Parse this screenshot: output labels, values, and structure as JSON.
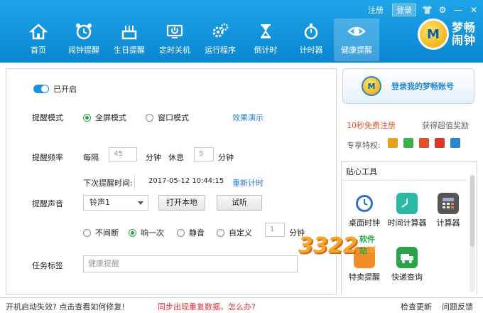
{
  "window": {
    "register_label": "注册",
    "login_label": "登录",
    "icons": [
      "shirt-icon",
      "gear-icon",
      "minimize-icon",
      "close-icon"
    ]
  },
  "nav": {
    "items": [
      {
        "label": "首页",
        "icon": "home-icon"
      },
      {
        "label": "闹钟提醒",
        "icon": "alarm-clock-icon"
      },
      {
        "label": "生日提醒",
        "icon": "birthday-cake-icon"
      },
      {
        "label": "定时关机",
        "icon": "power-icon"
      },
      {
        "label": "运行程序",
        "icon": "gears-icon"
      },
      {
        "label": "倒计时",
        "icon": "hourglass-icon"
      },
      {
        "label": "计时器",
        "icon": "stopwatch-icon"
      },
      {
        "label": "健康提醒",
        "icon": "eye-icon"
      }
    ],
    "active_index": 7
  },
  "brand": {
    "line1": "梦畅",
    "line2": "闹钟",
    "logo_letter": "M"
  },
  "main": {
    "enabled_label": "已开启",
    "mode": {
      "label": "提醒模式",
      "options": [
        "全屏模式",
        "窗口模式"
      ],
      "selected": "全屏模式",
      "demo_link": "效果演示"
    },
    "frequency": {
      "label": "提醒频率",
      "every_label": "每隔",
      "every_value": "45",
      "every_unit": "分钟",
      "rest_label": "休息",
      "rest_value": "5",
      "rest_unit": "分钟",
      "next_label": "下次提醒时间:",
      "next_time": "2017-05-12 10:44:15",
      "reset_link": "重新计时"
    },
    "sound": {
      "label": "提醒声音",
      "selected_sound": "铃声1",
      "open_local_button": "打开本地",
      "listen_button": "试听",
      "options": [
        "不间断",
        "响一次",
        "静音",
        "自定义"
      ],
      "selected_option": "响一次",
      "custom_value": "1",
      "custom_unit": "分钟"
    },
    "task": {
      "label": "任务标签",
      "value": "健康提醒"
    }
  },
  "right": {
    "login_text": "登录我的梦畅账号",
    "free_register": "10秒免费注册",
    "get_reward": "获得超值奖励",
    "vip_label": "专享特权:",
    "tools_title": "贴心工具",
    "tools": [
      {
        "label": "桌面时钟",
        "icon": "desktop-clock-icon"
      },
      {
        "label": "时间计算器",
        "icon": "time-calculator-icon"
      },
      {
        "label": "计算器",
        "icon": "calculator-icon"
      },
      {
        "label": "特卖提醒",
        "icon": "sale-tag-icon"
      },
      {
        "label": "快递查询",
        "icon": "delivery-truck-icon"
      }
    ]
  },
  "watermark": {
    "number": "3322",
    "site": "软件站",
    "tld": ".cc"
  },
  "footer": {
    "left": "开机启动失效? 点击查看如何修复!",
    "center": "同步出现重复数据，怎么办?",
    "check_update": "检查更新",
    "feedback": "问题反馈"
  },
  "colors": {
    "accent": "#0a86d2",
    "link": "#2a7ad4",
    "alert": "#e0522b",
    "selected_radio": "#2aa34a"
  }
}
